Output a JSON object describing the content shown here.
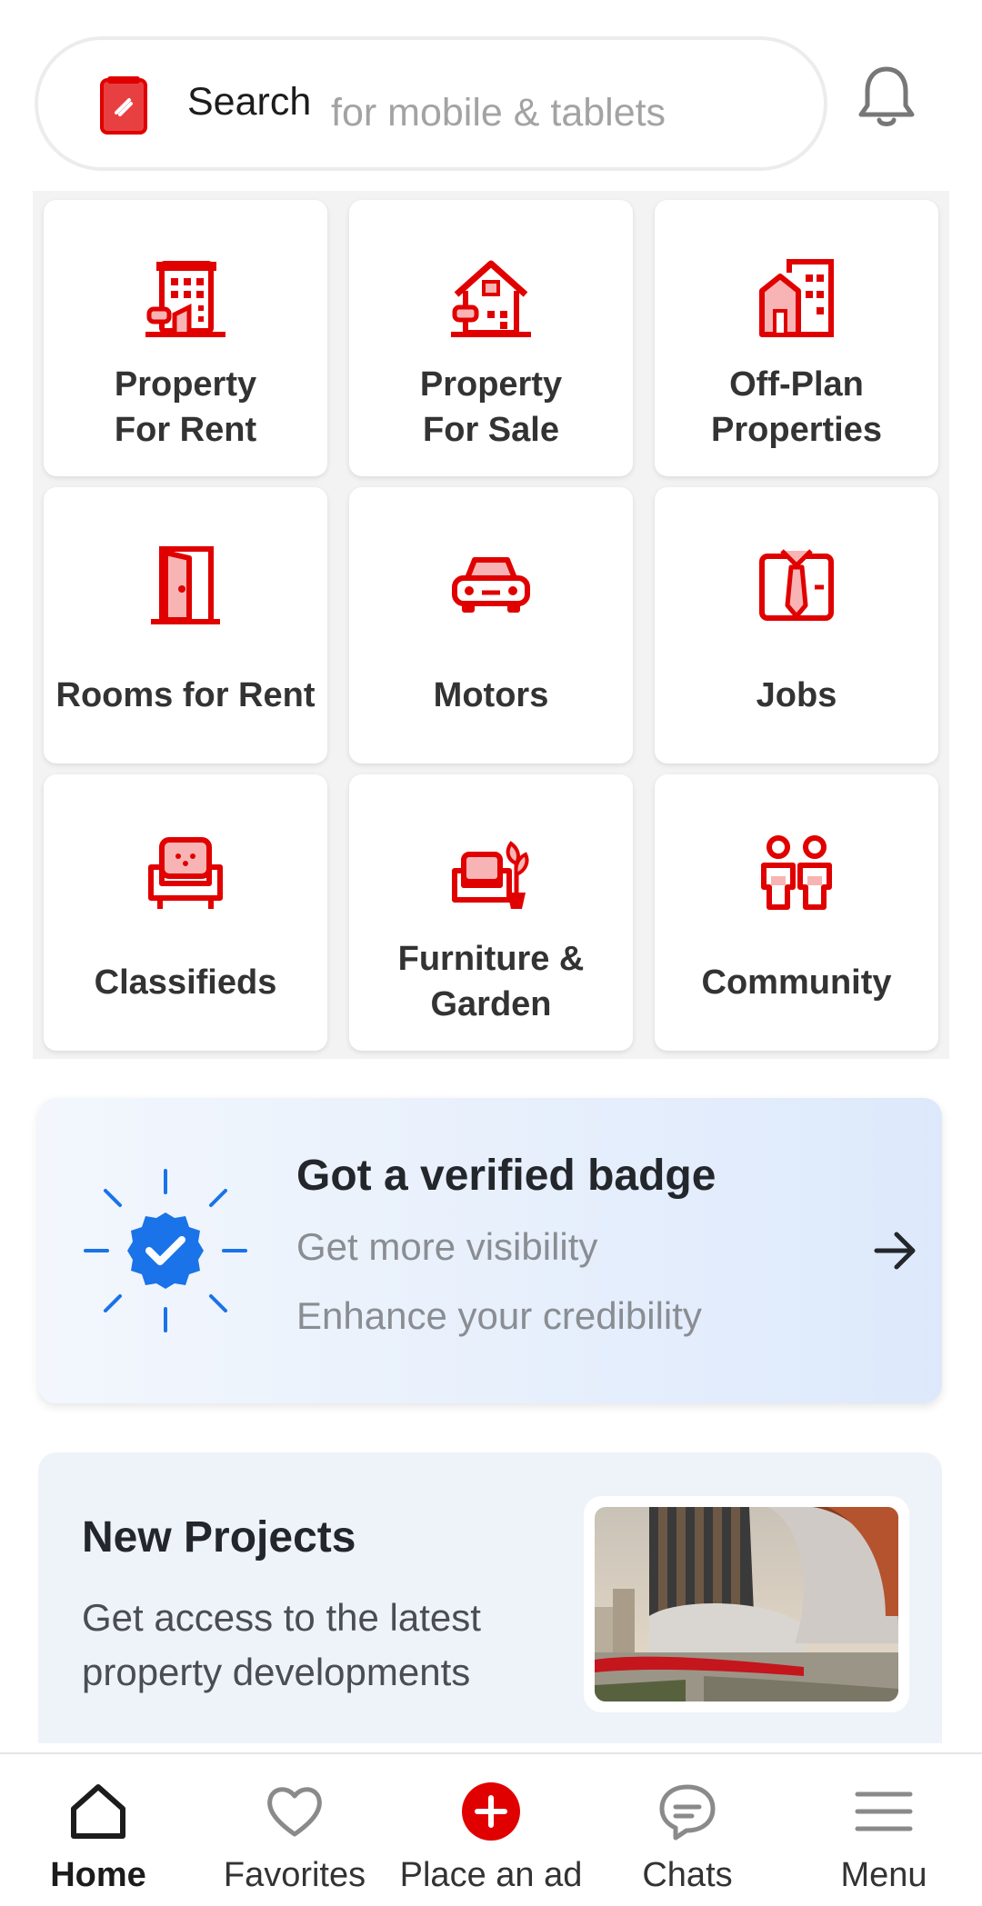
{
  "header": {
    "search_label": "Search",
    "search_hint": "for mobile & tablets",
    "logo_icon": "dubizzle-logo",
    "bell_icon": "bell-icon"
  },
  "categories": [
    {
      "label_line1": "Property",
      "label_line2": "For Rent",
      "icon": "building-icon"
    },
    {
      "label_line1": "Property",
      "label_line2": "For Sale",
      "icon": "house-icon"
    },
    {
      "label_line1": "Off-Plan",
      "label_line2": "Properties",
      "icon": "offplan-building-icon"
    },
    {
      "label": "Rooms for Rent",
      "icon": "door-icon"
    },
    {
      "label": "Motors",
      "icon": "car-icon"
    },
    {
      "label": "Jobs",
      "icon": "shirt-tie-icon"
    },
    {
      "label": "Classifieds",
      "icon": "armchair-icon"
    },
    {
      "label_line1": "Furniture &",
      "label_line2": "Garden",
      "icon": "sofa-plant-icon"
    },
    {
      "label": "Community",
      "icon": "people-icon"
    }
  ],
  "verified": {
    "title": "Got a verified badge",
    "line1": "Get more visibility",
    "line2": "Enhance your credibility"
  },
  "projects": {
    "title": "New Projects",
    "description": "Get access to the latest property developments"
  },
  "nav": {
    "home": "Home",
    "favorites": "Favorites",
    "place_ad": "Place an ad",
    "chats": "Chats",
    "menu": "Menu"
  },
  "colors": {
    "brand_red": "#e00000",
    "verified_blue": "#1a73e8"
  }
}
